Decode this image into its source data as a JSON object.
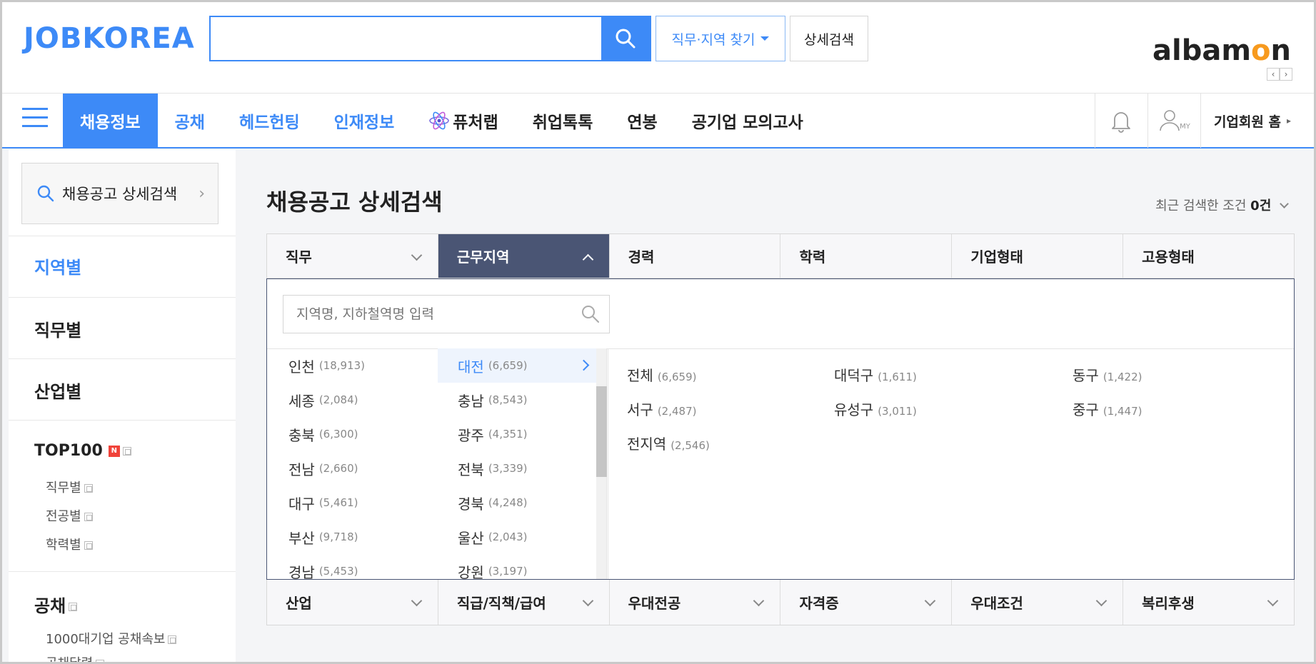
{
  "header": {
    "logo": "JOBKOREA",
    "search_placeholder": "",
    "find_dropdown": "직무·지역 찾기",
    "detail_search": "상세검색",
    "albamon_pre": "albam",
    "albamon_o": "o",
    "albamon_post": "n",
    "prev_arrow": "‹",
    "next_arrow": "›"
  },
  "nav": {
    "items": [
      "채용정보",
      "공채",
      "헤드헌팅",
      "인재정보",
      "퓨처랩",
      "취업톡톡",
      "연봉",
      "공기업 모의고사"
    ],
    "my_label": "MY",
    "corp_home": "기업회원 홈"
  },
  "sidebar": {
    "search_label": "채용공고 상세검색",
    "by_region": "지역별",
    "by_job": "직무별",
    "by_industry": "산업별",
    "top100": "TOP100",
    "new_badge": "N",
    "top100_subs": [
      "직무별",
      "전공별",
      "학력별"
    ],
    "gongchae": "공채",
    "gongchae_subs": [
      "1000대기업 공채속보",
      "공채달력"
    ]
  },
  "main": {
    "title": "채용공고 상세검색",
    "recent_label": "최근 검색한 조건",
    "recent_count": "0건",
    "tabs": [
      "직무",
      "근무지역",
      "경력",
      "학력",
      "기업형태",
      "고용형태"
    ],
    "tabs2": [
      "산업",
      "직급/직책/급여",
      "우대전공",
      "자격증",
      "우대조건",
      "복리후생"
    ],
    "region_search_placeholder": "지역명, 지하철역명 입력",
    "col1": [
      {
        "name": "인천",
        "count": "(18,913)"
      },
      {
        "name": "세종",
        "count": "(2,084)"
      },
      {
        "name": "충북",
        "count": "(6,300)"
      },
      {
        "name": "전남",
        "count": "(2,660)"
      },
      {
        "name": "대구",
        "count": "(5,461)"
      },
      {
        "name": "부산",
        "count": "(9,718)"
      },
      {
        "name": "경남",
        "count": "(5,453)"
      }
    ],
    "col2": [
      {
        "name": "대전",
        "count": "(6,659)"
      },
      {
        "name": "충남",
        "count": "(8,543)"
      },
      {
        "name": "광주",
        "count": "(4,351)"
      },
      {
        "name": "전북",
        "count": "(3,339)"
      },
      {
        "name": "경북",
        "count": "(4,248)"
      },
      {
        "name": "울산",
        "count": "(2,043)"
      },
      {
        "name": "강원",
        "count": "(3,197)"
      }
    ],
    "districts": [
      {
        "name": "전체",
        "count": "(6,659)"
      },
      {
        "name": "대덕구",
        "count": "(1,611)"
      },
      {
        "name": "동구",
        "count": "(1,422)"
      },
      {
        "name": "서구",
        "count": "(2,487)"
      },
      {
        "name": "유성구",
        "count": "(3,011)"
      },
      {
        "name": "중구",
        "count": "(1,447)"
      },
      {
        "name": "전지역",
        "count": "(2,546)"
      }
    ]
  },
  "colors": {
    "brand_blue": "#3d8af7",
    "active_tab": "#4a5574",
    "albamon_accent": "#f79a1e",
    "new_badge": "#f0433a"
  },
  "icons": [
    "search-icon",
    "caret-down-icon",
    "hamburger-icon",
    "atom-icon",
    "bell-icon",
    "user-icon",
    "chevron-right-icon",
    "chevron-down-icon",
    "chevron-up-icon"
  ]
}
